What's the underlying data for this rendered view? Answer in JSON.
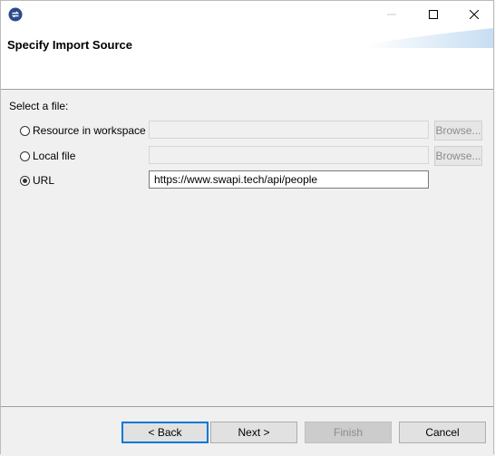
{
  "window": {
    "min_label": "—",
    "max_label": "☐",
    "close_label": "✕"
  },
  "header": {
    "title": "Specify Import Source"
  },
  "form": {
    "select_label": "Select a file:",
    "options": [
      {
        "label": "Resource in workspace",
        "checked": false,
        "value": "",
        "browse_label": "Browse..."
      },
      {
        "label": "Local file",
        "checked": false,
        "value": "",
        "browse_label": "Browse..."
      },
      {
        "label": "URL",
        "checked": true,
        "value": "https://www.swapi.tech/api/people"
      }
    ]
  },
  "buttons": {
    "back": "< Back",
    "next": "Next >",
    "finish": "Finish",
    "cancel": "Cancel"
  },
  "colors": {
    "accent": "#0078d7",
    "app_icon": "#2a4a8a"
  }
}
